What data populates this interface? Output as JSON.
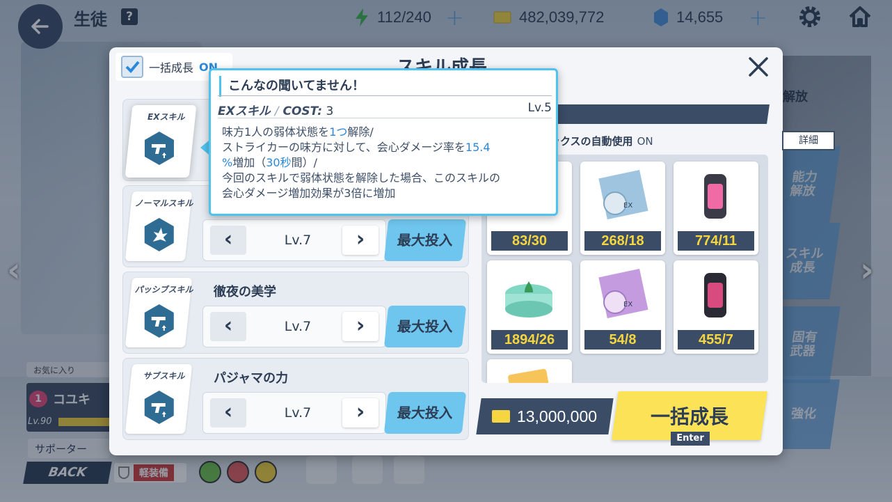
{
  "topbar": {
    "title": "生徒",
    "help": "?",
    "ap": "112/240",
    "credits": "482,039,772",
    "gems": "14,655"
  },
  "modal": {
    "title": "スキル成長",
    "bulk_toggle_label": "一括成長",
    "bulk_toggle_state": "ON"
  },
  "skills": [
    {
      "type": "EXスキル",
      "name": "",
      "level": "",
      "max_label": ""
    },
    {
      "type": "ノーマルスキル",
      "name": "",
      "level": "Lv.7",
      "max_label": "最大投入"
    },
    {
      "type": "パッシブスキル",
      "name": "徹夜の美学",
      "level": "Lv.7",
      "max_label": "最大投入"
    },
    {
      "type": "サブスキル",
      "name": "パジャマの力",
      "level": "Lv.7",
      "max_label": "最大投入"
    }
  ],
  "tooltip": {
    "title": "こんなの聞いてません！",
    "kind": "EXスキル",
    "sep": "/",
    "cost_label": "COST:",
    "cost_value": "3",
    "level": "Lv.5",
    "desc": {
      "l1a": "味方1人の弱体状態を",
      "l1b": "1つ",
      "l1c": "解除/",
      "l2a": "ストライカーの味方に対して、会心ダメージ率を",
      "l2b": "15.4",
      "l3a": "%",
      "l3b": "増加（",
      "l3c": "30秒",
      "l3d": "間）/",
      "l4": "今回のスキルで弱体状態を解除した場合、このスキルの",
      "l5": "会心ダメージ増加効果が3倍に増加"
    }
  },
  "auto_use": {
    "label": "ックスの自動使用",
    "state": "ON"
  },
  "detail_button": "詳細",
  "materials": [
    {
      "count": "83/30",
      "kind": "orange-report"
    },
    {
      "count": "268/18",
      "kind": "ex-disc-blue"
    },
    {
      "count": "774/11",
      "kind": "pink-lantern"
    },
    {
      "count": "1894/26",
      "kind": "green-jar"
    },
    {
      "count": "54/8",
      "kind": "ex-disc-purple"
    },
    {
      "count": "455/7",
      "kind": "dark-lantern"
    }
  ],
  "cost": "13,000,000",
  "bulk_button": "一括成長",
  "enter_hint": "Enter",
  "right_menu": {
    "tag": "解放",
    "items": [
      "能力\n解放",
      "スキル\n成長",
      "固有\n武器",
      "強化"
    ]
  },
  "bottom": {
    "favorite": "お気に入り",
    "char_name": "コユキ",
    "affection": "1",
    "char_level": "Lv.90",
    "supporter": "サポーター",
    "back": "BACK",
    "equip": "軽装備"
  },
  "colors": {
    "accent": "#4fc3ef",
    "navy": "#3a4c66",
    "yellow": "#fbe256",
    "highlight": "#2a88dc"
  }
}
